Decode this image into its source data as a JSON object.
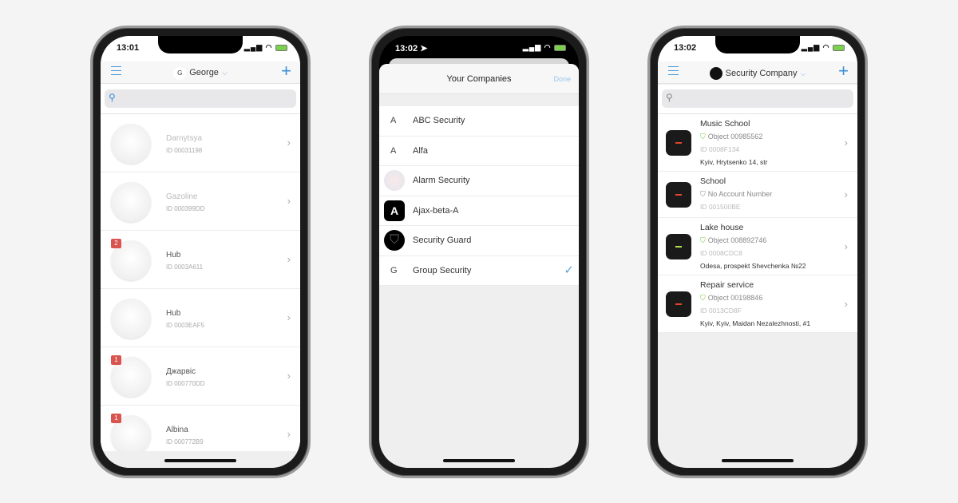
{
  "phone1": {
    "time": "13:01",
    "account_initial": "G",
    "account_name": "George",
    "hubs": [
      {
        "name": "Darnytsya",
        "id": "ID 00031198",
        "badge": null,
        "dim": true
      },
      {
        "name": "Gazoline",
        "id": "ID 000399DD",
        "badge": null,
        "dim": true
      },
      {
        "name": "Hub",
        "id": "ID 0003A611",
        "badge": "2",
        "dim": false
      },
      {
        "name": "Hub",
        "id": "ID 0003EAF5",
        "badge": null,
        "dim": false
      },
      {
        "name": "Джарвіс",
        "id": "ID 000770DD",
        "badge": "1",
        "dim": false
      },
      {
        "name": "Albina",
        "id": "ID 000772B9",
        "badge": "1",
        "dim": false
      }
    ]
  },
  "phone2": {
    "time": "13:02",
    "title": "Your Companies",
    "done": "Done",
    "companies": [
      {
        "letter": "A",
        "name": "ABC Security",
        "logo": "letter"
      },
      {
        "letter": "A",
        "name": "Alfa",
        "logo": "letter"
      },
      {
        "letter": "",
        "name": "Alarm Security",
        "logo": "sketch-logo"
      },
      {
        "letter": "A",
        "name": "Ajax-beta-A",
        "logo": "black-square-A"
      },
      {
        "letter": "",
        "name": "Security Guard",
        "logo": "black-shield"
      },
      {
        "letter": "G",
        "name": "Group Security",
        "logo": "letter",
        "selected": true
      }
    ]
  },
  "phone3": {
    "time": "13:02",
    "company": "Security Company",
    "objects": [
      {
        "name": "Music School",
        "account": "Object 00985562",
        "id": "ID 0008F134",
        "address": "Kyiv, Hrytsenko 14, str",
        "led": "#e0452e",
        "shield": "green"
      },
      {
        "name": "School",
        "account": "No Account Number",
        "id": "ID 001500BE",
        "address": "",
        "led": "#e0452e",
        "shield": "gray"
      },
      {
        "name": "Lake house",
        "account": "Object 008892746",
        "id": "ID 0008CDC8",
        "address": "Odesa, prospekt Shevchenka №22",
        "led": "#b4e04a",
        "shield": "green"
      },
      {
        "name": "Repair service",
        "account": "Object 00198846",
        "id": "ID 0013CD8F",
        "address": "Kyiv, Kyiv, Maidan Nezalezhnosti, #1",
        "led": "#e0452e",
        "shield": "green"
      }
    ]
  },
  "colors": {
    "accent": "#3b8fd5",
    "badge": "#d9534f",
    "shield_ok": "#7ac143"
  }
}
